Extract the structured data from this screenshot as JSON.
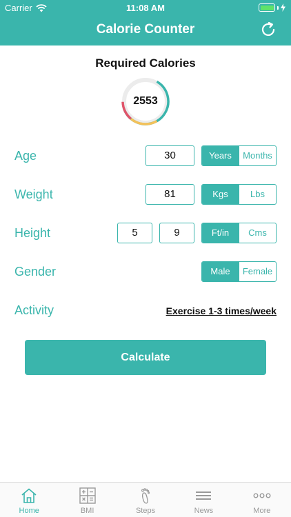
{
  "status": {
    "carrier": "Carrier",
    "time": "11:08 AM"
  },
  "header": {
    "title": "Calorie Counter"
  },
  "summary": {
    "label": "Required Calories",
    "value": "2553"
  },
  "age": {
    "label": "Age",
    "value": "30",
    "options": [
      "Years",
      "Months"
    ],
    "selected": "Years"
  },
  "weight": {
    "label": "Weight",
    "value": "81",
    "options": [
      "Kgs",
      "Lbs"
    ],
    "selected": "Kgs"
  },
  "height": {
    "label": "Height",
    "feet": "5",
    "inches": "9",
    "options": [
      "Ft/in",
      "Cms"
    ],
    "selected": "Ft/in"
  },
  "gender": {
    "label": "Gender",
    "options": [
      "Male",
      "Female"
    ],
    "selected": "Male"
  },
  "activity": {
    "label": "Activity",
    "value": "Exercise 1-3 times/week"
  },
  "calculate": {
    "label": "Calculate"
  },
  "tabs": [
    {
      "label": "Home",
      "icon": "home-icon",
      "active": true
    },
    {
      "label": "BMI",
      "icon": "calculator-icon",
      "active": false
    },
    {
      "label": "Steps",
      "icon": "footprint-icon",
      "active": false
    },
    {
      "label": "News",
      "icon": "news-icon",
      "active": false
    },
    {
      "label": "More",
      "icon": "more-icon",
      "active": false
    }
  ],
  "colors": {
    "accent": "#3ab5ac",
    "battery": "#5fe36a",
    "gauge_red": "#e0546a",
    "gauge_yellow": "#f4c15a"
  }
}
